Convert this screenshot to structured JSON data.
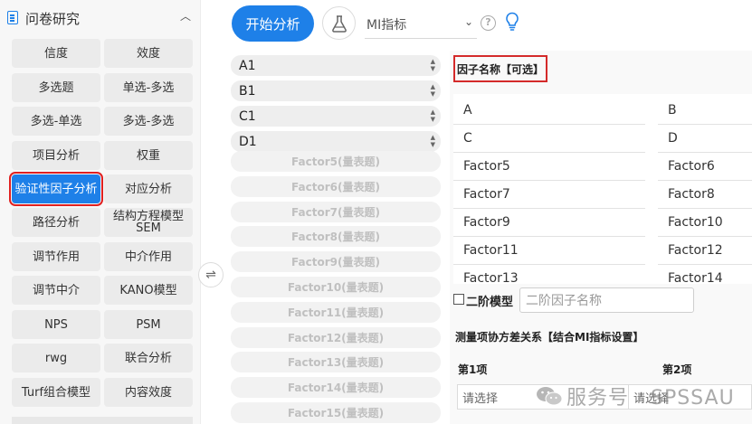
{
  "sidebar": {
    "title": "问卷研究",
    "methods": [
      {
        "label": "信度"
      },
      {
        "label": "效度"
      },
      {
        "label": "多选题"
      },
      {
        "label": "单选-多选"
      },
      {
        "label": "多选-单选"
      },
      {
        "label": "多选-多选"
      },
      {
        "label": "项目分析"
      },
      {
        "label": "权重"
      },
      {
        "label": "验证性因子分析",
        "active": true
      },
      {
        "label": "对应分析"
      },
      {
        "label": "路径分析"
      },
      {
        "label": "结构方程模型SEM"
      },
      {
        "label": "调节作用"
      },
      {
        "label": "中介作用"
      },
      {
        "label": "调节中介"
      },
      {
        "label": "KANO模型"
      },
      {
        "label": "NPS"
      },
      {
        "label": "PSM"
      },
      {
        "label": "rwg"
      },
      {
        "label": "联合分析"
      },
      {
        "label": "Turf组合模型"
      },
      {
        "label": "内容效度"
      }
    ]
  },
  "toolbar": {
    "start_label": "开始分析",
    "index_select": "MI指标",
    "help_glyph": "?"
  },
  "variables": {
    "items": [
      "A1",
      "B1",
      "C1",
      "D1"
    ],
    "factors": [
      "Factor5(量表题)",
      "Factor6(量表题)",
      "Factor7(量表题)",
      "Factor8(量表题)",
      "Factor9(量表题)",
      "Factor10(量表题)",
      "Factor11(量表题)",
      "Factor12(量表题)",
      "Factor13(量表题)",
      "Factor14(量表题)",
      "Factor15(量表题)"
    ]
  },
  "right_panel": {
    "factor_name_title": "因子名称【可选】",
    "factor_names": [
      "A",
      "B",
      "C",
      "D",
      "Factor5",
      "Factor6",
      "Factor7",
      "Factor8",
      "Factor9",
      "Factor10",
      "Factor11",
      "Factor12",
      "Factor13",
      "Factor14"
    ],
    "second_order_label": "二阶模型",
    "second_order_placeholder": "二阶因子名称",
    "cov_title": "测量项协方差关系【结合MI指标设置】",
    "cov_col_1": "第1项",
    "cov_col_2": "第2项",
    "cov_select_placeholder": "请选择"
  },
  "watermark": {
    "text": "服务号 · SPSSAU"
  },
  "colors": {
    "accent": "#1e80e8",
    "highlight_border": "#d42a2a"
  }
}
